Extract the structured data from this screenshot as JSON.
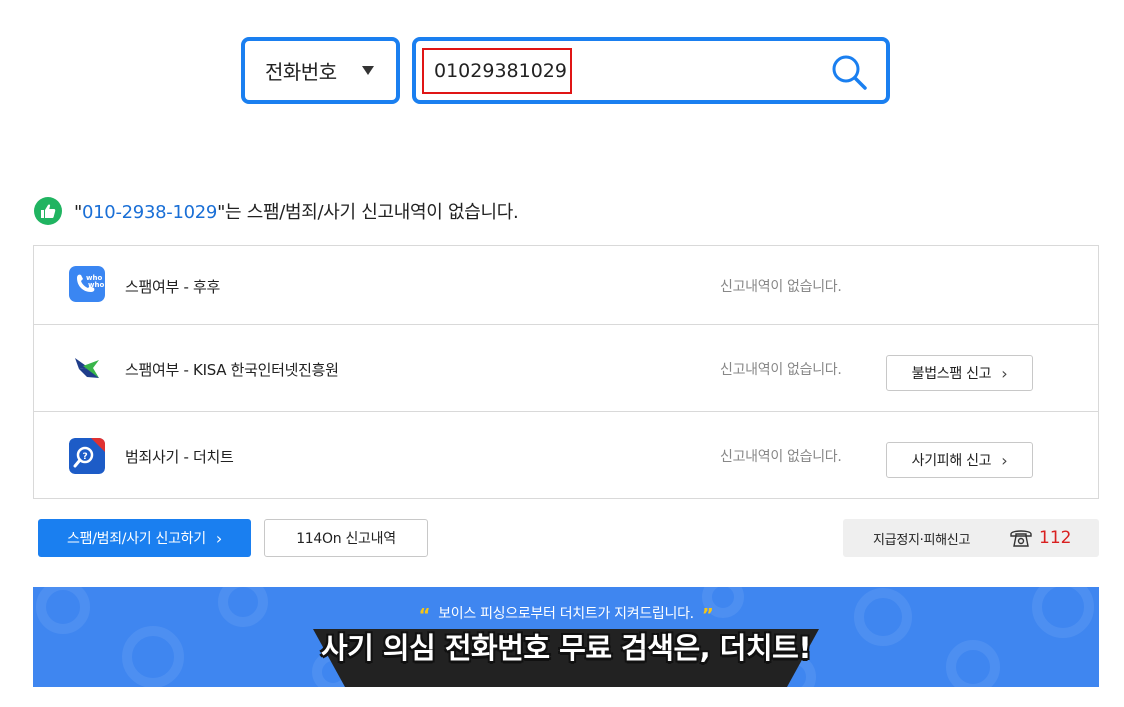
{
  "search": {
    "type_label": "전화번호",
    "query": "01029381029"
  },
  "result": {
    "quote_open": "\"",
    "number": "010-2938-1029",
    "message": "\"는 스팸/범죄/사기 신고내역이 없습니다."
  },
  "rows": [
    {
      "name": "스팸여부 - 후후",
      "status": "신고내역이 없습니다.",
      "button": ""
    },
    {
      "name": "스팸여부 - KISA 한국인터넷진흥원",
      "status": "신고내역이 없습니다.",
      "button": "불법스팸 신고"
    },
    {
      "name": "범죄사기 - 더치트",
      "status": "신고내역이 없습니다.",
      "button": "사기피해 신고"
    }
  ],
  "actions": {
    "report_label": "스팸/범죄/사기 신고하기",
    "history_label": "114On 신고내역",
    "hotline_label": "지급정지·피해신고",
    "hotline_number": "112"
  },
  "banner": {
    "slogan": "보이스 피싱으로부터 더치트가 지켜드립니다.",
    "headline": "사기 의심 전화번호 무료 검색은, 더치트!"
  },
  "colors": {
    "accent": "#1a7ff0",
    "highlight_border": "#e01515",
    "positive": "#20b461",
    "hotline_number": "#d92020",
    "banner_bg": "#3f86f0"
  },
  "icons": [
    "chevron-down-icon",
    "search-icon",
    "thumbs-up-icon",
    "whowho-app-icon",
    "kisa-logo-icon",
    "thecheat-app-icon",
    "chevron-right-icon",
    "phone-icon",
    "quote-icon"
  ]
}
